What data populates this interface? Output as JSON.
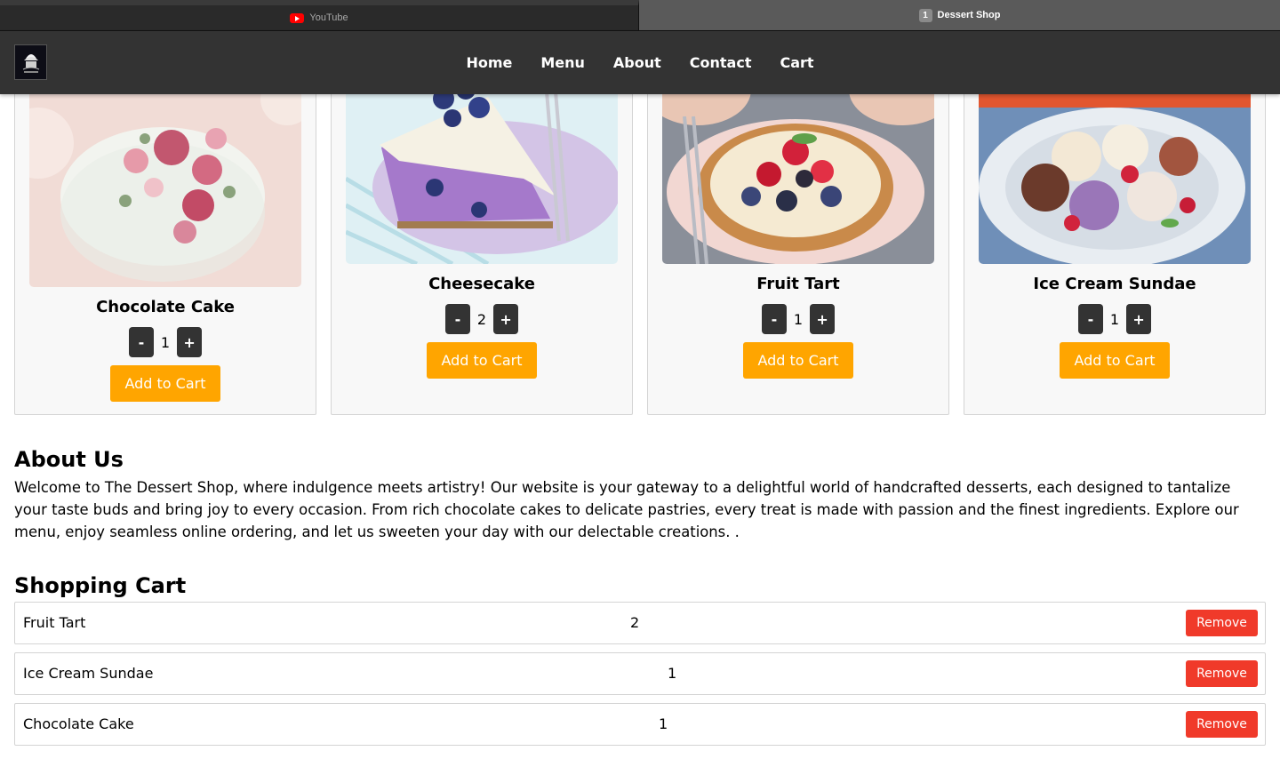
{
  "browser": {
    "tabs": [
      {
        "label": "YouTube",
        "icon": "youtube-icon",
        "active": false
      },
      {
        "label": "Dessert Shop",
        "badge": "1",
        "active": true
      }
    ]
  },
  "header": {
    "logo_icon": "cupcake-logo-icon",
    "nav": [
      "Home",
      "Menu",
      "About",
      "Contact",
      "Cart"
    ]
  },
  "products": [
    {
      "name": "Chocolate Cake",
      "quantity": "1",
      "add_label": "Add to Cart",
      "decrement_label": "-",
      "increment_label": "+"
    },
    {
      "name": "Cheesecake",
      "quantity": "2",
      "add_label": "Add to Cart",
      "decrement_label": "-",
      "increment_label": "+"
    },
    {
      "name": "Fruit Tart",
      "quantity": "1",
      "add_label": "Add to Cart",
      "decrement_label": "-",
      "increment_label": "+"
    },
    {
      "name": "Ice Cream Sundae",
      "quantity": "1",
      "add_label": "Add to Cart",
      "decrement_label": "-",
      "increment_label": "+"
    }
  ],
  "about": {
    "title": "About Us",
    "text": "Welcome to The Dessert Shop, where indulgence meets artistry! Our website is your gateway to a delightful world of handcrafted desserts, each designed to tantalize your taste buds and bring joy to every occasion. From rich chocolate cakes to delicate pastries, every treat is made with passion and the finest ingredients. Explore our menu, enjoy seamless online ordering, and let us sweeten your day with our delectable creations. ."
  },
  "cart": {
    "title": "Shopping Cart",
    "items": [
      {
        "name": "Fruit Tart",
        "quantity": "2",
        "remove_label": "Remove"
      },
      {
        "name": "Ice Cream Sundae",
        "quantity": "1",
        "remove_label": "Remove"
      },
      {
        "name": "Chocolate Cake",
        "quantity": "1",
        "remove_label": "Remove"
      }
    ]
  },
  "colors": {
    "header_bg": "#333333",
    "accent": "#ffa500",
    "remove": "#f03a2a"
  }
}
